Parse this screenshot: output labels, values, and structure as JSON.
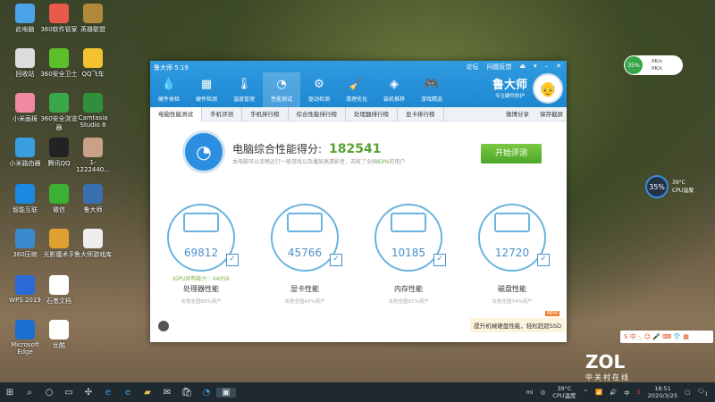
{
  "desktop": [
    {
      "label": "此电脑",
      "color": "#4aa3e8"
    },
    {
      "label": "360软件管家",
      "color": "#e85a4a"
    },
    {
      "label": "英雄联盟",
      "color": "#b08a3a"
    },
    {
      "label": "回收站",
      "color": "#ddd"
    },
    {
      "label": "360安全卫士",
      "color": "#5cbf2a"
    },
    {
      "label": "QQ飞车",
      "color": "#f2c230"
    },
    {
      "label": "小米画报",
      "color": "#f08aa0"
    },
    {
      "label": "360安全浏览器",
      "color": "#3aa84a"
    },
    {
      "label": "Camtasia Studio 8",
      "color": "#2f8f3a"
    },
    {
      "label": "小米路由器",
      "color": "#3a9fe0"
    },
    {
      "label": "腾讯QQ",
      "color": "#222"
    },
    {
      "label": "1-1222440...",
      "color": "#c9a088"
    },
    {
      "label": "智能互联",
      "color": "#1a8ae0"
    },
    {
      "label": "微信",
      "color": "#3cb034"
    },
    {
      "label": "鲁大师",
      "color": "#3a70b0"
    },
    {
      "label": "360压缩",
      "color": "#3a8ad0"
    },
    {
      "label": "光影魔术手",
      "color": "#e0a030"
    },
    {
      "label": "鲁大师游戏库",
      "color": "#eee"
    },
    {
      "label": "WPS 2019",
      "color": "#2a6ad8"
    },
    {
      "label": "石墨文档",
      "color": "#fff"
    },
    {
      "label": "Microsoft Edge",
      "color": "#1a70d0"
    },
    {
      "label": "优酷",
      "color": "#fff"
    }
  ],
  "window": {
    "title": "鲁大师 5.19",
    "controls": [
      "论坛",
      "问题反馈",
      "⏏",
      "▾",
      "–",
      "✕"
    ],
    "tools": [
      {
        "label": "硬件体检",
        "icon": "💧"
      },
      {
        "label": "硬件检测",
        "icon": "▦"
      },
      {
        "label": "温度管理",
        "icon": "🌡"
      },
      {
        "label": "性能测试",
        "icon": "◔"
      },
      {
        "label": "驱动检测",
        "icon": "⚙"
      },
      {
        "label": "清理优化",
        "icon": "🧹"
      },
      {
        "label": "装机推荐",
        "icon": "◈"
      },
      {
        "label": "游戏精选",
        "icon": "🎮"
      }
    ],
    "brand": "鲁大师",
    "slogan": "专注硬件防护",
    "tabs": [
      "电脑性能测试",
      "手机评测",
      "手机排行榜",
      "综合性能排行榜",
      "处理器排行榜",
      "显卡排行榜"
    ],
    "share": "微博分享",
    "screenshot": "保存截屏",
    "score_label": "电脑综合性能得分:",
    "score": "182541",
    "score_desc": "本电脑可以流畅运行一般游戏以及播放高清影音，击败了全国",
    "score_pct": "63%",
    "score_desc_end": "的用户",
    "start": "开始评测",
    "cards": [
      {
        "score": "69812",
        "igpu": "IGPU异构能力：44058",
        "name": "处理器性能",
        "beat": "击败全国68%用户"
      },
      {
        "score": "45766",
        "igpu": "",
        "name": "显卡性能",
        "beat": "击败全国45%用户"
      },
      {
        "score": "10185",
        "igpu": "",
        "name": "内存性能",
        "beat": "击败全国91%用户"
      },
      {
        "score": "12720",
        "igpu": "",
        "name": "磁盘性能",
        "beat": "击败全国74%用户"
      }
    ],
    "ssd_badge": "NEW",
    "ssd": "提升机械硬盘性能，轻松赶超SSD"
  },
  "widgets": {
    "mem": "35%",
    "up": "0K/s",
    "down": "0K/s",
    "cpu_pct": "35%",
    "cpu_temp": "39°C",
    "cpu_label": "CPU温度"
  },
  "ime": "S 中 ·, ☺ 🎤 ⌨ 👕 ▦",
  "watermark": {
    "logo": "ZOL",
    "sub": "中关村在线"
  },
  "taskbar": {
    "temp": "39°C",
    "temp_label": "CPU温度",
    "ime": "中",
    "time": "18:51",
    "date": "2020/3/25",
    "notif": "1"
  }
}
